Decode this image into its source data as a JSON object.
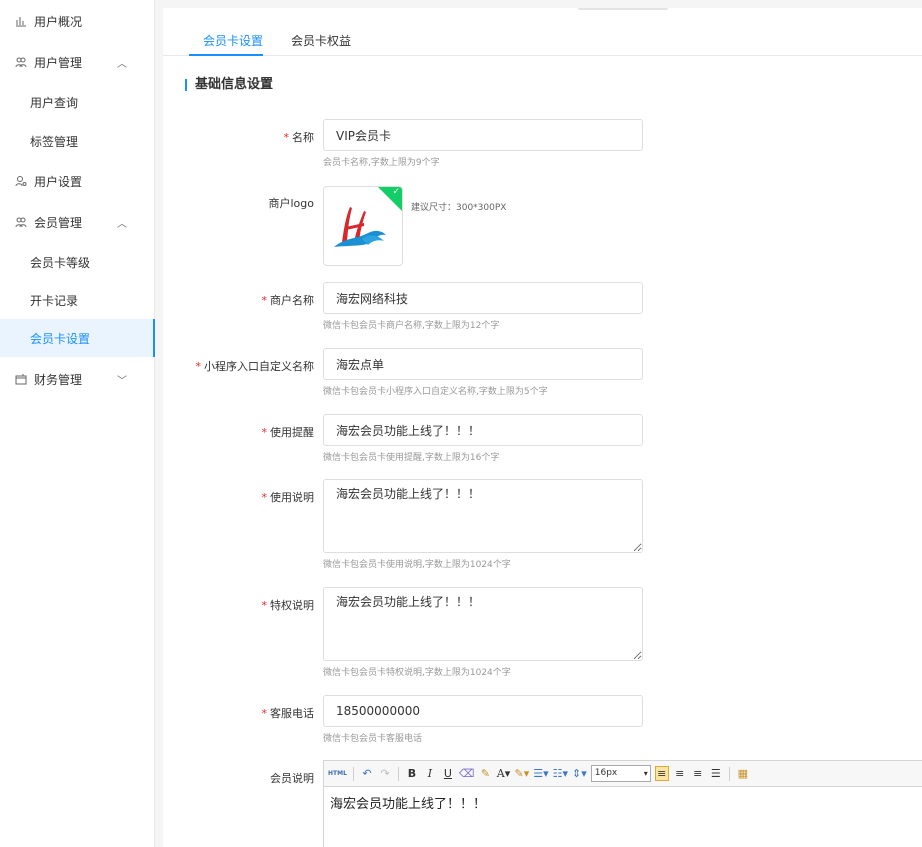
{
  "sidebar": {
    "items": [
      {
        "label": "用户概况",
        "icon": "bar-chart-icon"
      },
      {
        "label": "用户管理",
        "icon": "user-group-icon",
        "expanded": true
      },
      {
        "label": "用户查询"
      },
      {
        "label": "标签管理"
      },
      {
        "label": "用户设置",
        "icon": "user-settings-icon"
      },
      {
        "label": "会员管理",
        "icon": "member-icon",
        "expanded": true
      },
      {
        "label": "会员卡等级"
      },
      {
        "label": "开卡记录"
      },
      {
        "label": "会员卡设置",
        "active": true
      },
      {
        "label": "财务管理",
        "icon": "wallet-icon",
        "expanded": false
      }
    ]
  },
  "tabs": [
    {
      "label": "会员卡设置",
      "active": true
    },
    {
      "label": "会员卡权益",
      "active": false
    }
  ],
  "section_title": "基础信息设置",
  "form": {
    "name": {
      "label": "名称",
      "value": "VIP会员卡",
      "hint": "会员卡名称,字数上限为9个字"
    },
    "logo": {
      "label": "商户logo",
      "hint": "建议尺寸：300*300PX"
    },
    "merchant": {
      "label": "商户名称",
      "value": "海宏网络科技",
      "hint": "微信卡包会员卡商户名称,字数上限为12个字"
    },
    "miniapp": {
      "label": "小程序入口自定义名称",
      "value": "海宏点单",
      "hint": "微信卡包会员卡小程序入口自定义名称,字数上限为5个字"
    },
    "notice": {
      "label": "使用提醒",
      "value": "海宏会员功能上线了！！！",
      "hint": "微信卡包会员卡使用提醒,字数上限为16个字"
    },
    "usage": {
      "label": "使用说明",
      "value": "海宏会员功能上线了！！！",
      "hint": "微信卡包会员卡使用说明,字数上限为1024个字"
    },
    "privilege": {
      "label": "特权说明",
      "value": "海宏会员功能上线了！！！",
      "hint": "微信卡包会员卡特权说明,字数上限为1024个字"
    },
    "phone": {
      "label": "客服电话",
      "value": "18500000000",
      "hint": "微信卡包会员卡客服电话"
    },
    "member_desc": {
      "label": "会员说明",
      "content": "海宏会员功能上线了！！！"
    }
  },
  "editor": {
    "font_size": "16px",
    "html_label": "HTML"
  },
  "colors": {
    "accent": "#1890ff",
    "required": "#f5222d",
    "success": "#13ce66"
  }
}
